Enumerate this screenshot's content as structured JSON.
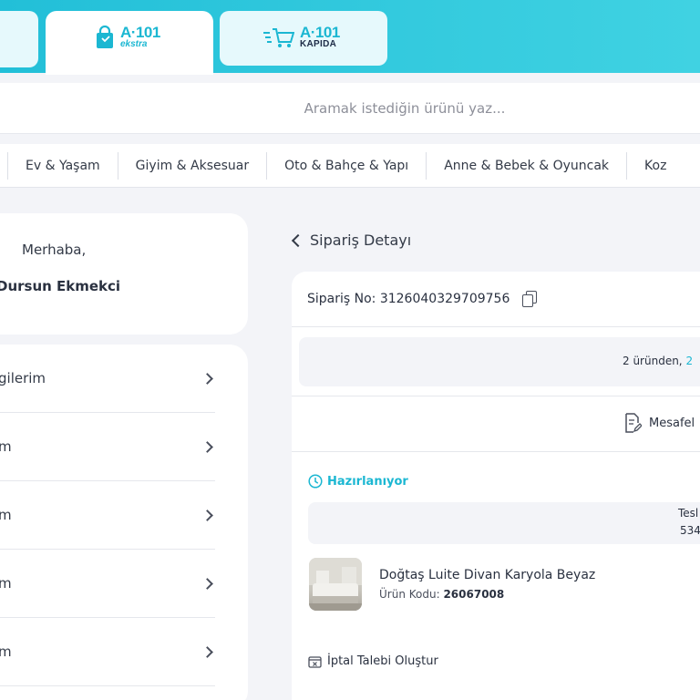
{
  "header": {
    "tabs": [
      {
        "brand": "A·101",
        "sub": "ekstra",
        "icon": "shopping-bag-icon",
        "active": true
      },
      {
        "brand": "A·101",
        "sub": "KAPIDA",
        "icon": "delivery-cart-icon",
        "active": false
      }
    ]
  },
  "search": {
    "placeholder": "Aramak istediğin ürünü yaz..."
  },
  "categories": [
    "Ev & Yaşam",
    "Giyim & Aksesuar",
    "Oto & Bahçe & Yapı",
    "Anne & Bebek & Oyuncak",
    "Koz"
  ],
  "account": {
    "greeting": "Merhaba,",
    "user_name": "Dursun Ekmekci",
    "menu": [
      {
        "label": "gilerim"
      },
      {
        "label": "m"
      },
      {
        "label": "m"
      },
      {
        "label": "m"
      },
      {
        "label": "m"
      }
    ]
  },
  "order": {
    "back_title": "Sipariş Detayı",
    "order_no": "Sipariş No: 3126040329709756",
    "summary_prefix": "2 üründen, ",
    "summary_highlight": "2",
    "contract_label": "Mesafel",
    "status": "Hazırlanıyor",
    "delivery_label": "Tesl",
    "delivery_code": "534",
    "product": {
      "name": "Doğtaş Luite Divan Karyola Beyaz",
      "code_label": "Ürün Kodu:",
      "code_value": "26067008"
    },
    "cancel_label": "İptal Talebi Oluştur"
  },
  "colors": {
    "brand_teal": "#1bb7d2",
    "header_gradient_start": "#22bfd8",
    "header_gradient_end": "#40d2e2",
    "page_bg": "#f3f4f8"
  }
}
